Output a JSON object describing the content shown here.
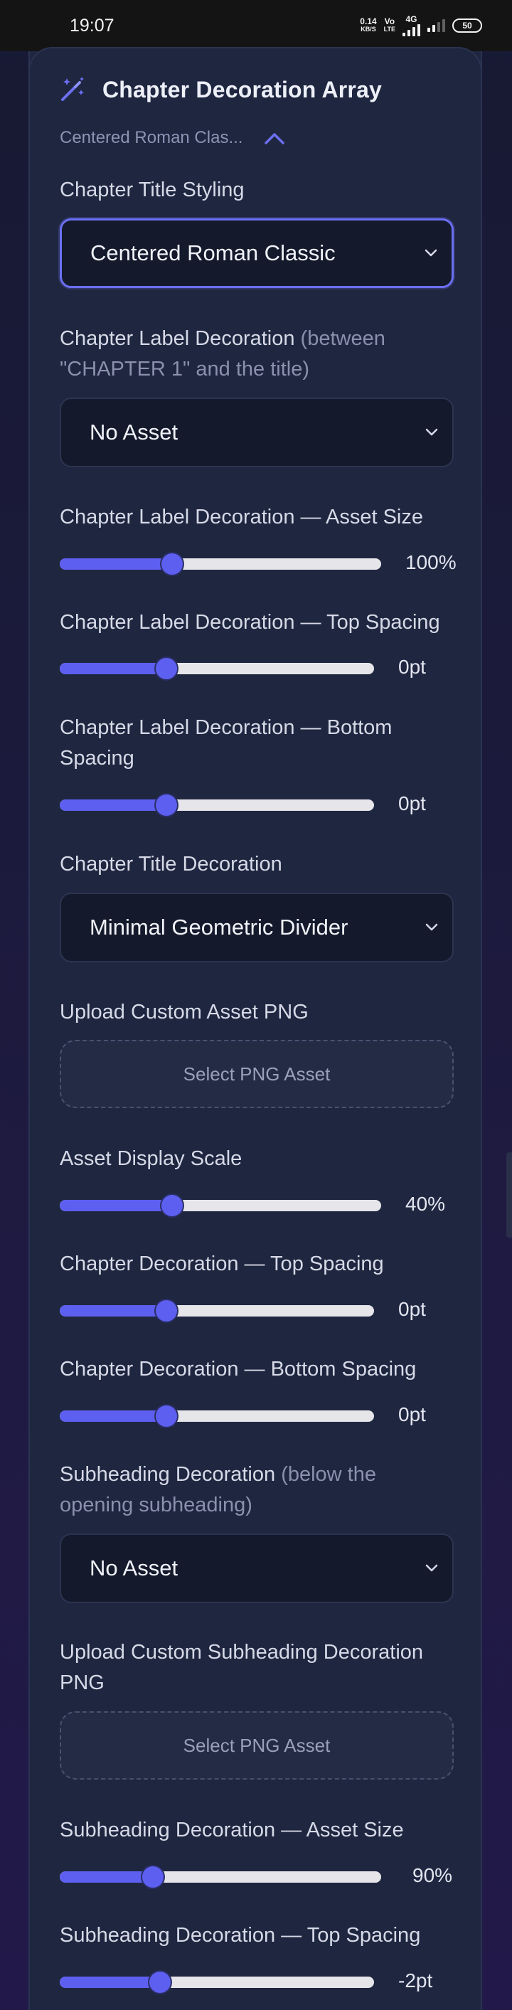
{
  "status_bar": {
    "time": "19:07",
    "net_speed": "0.14",
    "net_unit": "KB/S",
    "volte_top": "Vo",
    "volte_bottom": "LTE",
    "signal_label": "4G",
    "battery": "50"
  },
  "card": {
    "title": "Chapter Decoration Array",
    "current_style": "Centered Roman Clas..."
  },
  "fields": {
    "title_styling": {
      "label": "Chapter Title Styling",
      "value": "Centered Roman Classic"
    },
    "label_decoration": {
      "label": "Chapter Label Decoration",
      "hint": "(between",
      "hint2": "\"CHAPTER 1\" and the title)",
      "value": "No Asset"
    },
    "label_asset_size": {
      "label": "Chapter Label Decoration — Asset Size",
      "value": 100,
      "display": "100%"
    },
    "label_top_spacing": {
      "label": "Chapter Label Decoration — Top Spacing",
      "value": 0,
      "display": "0pt"
    },
    "label_bottom_spacing": {
      "label": "Chapter Label Decoration — Bottom",
      "label2": "Spacing",
      "value": 0,
      "display": "0pt"
    },
    "title_decoration": {
      "label": "Chapter Title Decoration",
      "value": "Minimal Geometric Divider"
    },
    "upload_asset": {
      "label": "Upload Custom Asset PNG",
      "button": "Select PNG Asset"
    },
    "display_scale": {
      "label": "Asset Display Scale",
      "value": 40,
      "display": "40%"
    },
    "decoration_top_spacing": {
      "label": "Chapter Decoration — Top Spacing",
      "value": 0,
      "display": "0pt"
    },
    "decoration_bottom_spacing": {
      "label": "Chapter Decoration — Bottom Spacing",
      "value": 0,
      "display": "0pt"
    },
    "subheading_decoration": {
      "label": "Subheading Decoration",
      "hint": "(below the",
      "hint2": "opening subheading)",
      "value": "No Asset"
    },
    "upload_subheading": {
      "label": "Upload Custom Subheading Decoration",
      "label2": "PNG",
      "button": "Select PNG Asset"
    },
    "subheading_asset_size": {
      "label": "Subheading Decoration — Asset Size",
      "value": 90,
      "display": "90%"
    },
    "subheading_top_spacing": {
      "label": "Subheading Decoration — Top Spacing",
      "value": -2,
      "display": "-2pt"
    }
  },
  "sliders": {
    "label_asset_size": {
      "fraction": 0.35
    },
    "label_top_spacing": {
      "fraction": 0.34
    },
    "label_bottom_spacing": {
      "fraction": 0.34
    },
    "display_scale": {
      "fraction": 0.35
    },
    "decoration_top_spacing": {
      "fraction": 0.34
    },
    "decoration_bottom_spacing": {
      "fraction": 0.34
    },
    "subheading_asset_size": {
      "fraction": 0.29
    },
    "subheading_top_spacing": {
      "fraction": 0.32
    }
  },
  "colors": {
    "accent": "#5d5ff0",
    "card_bg": "#1f2640",
    "field_bg": "#141a2c"
  }
}
